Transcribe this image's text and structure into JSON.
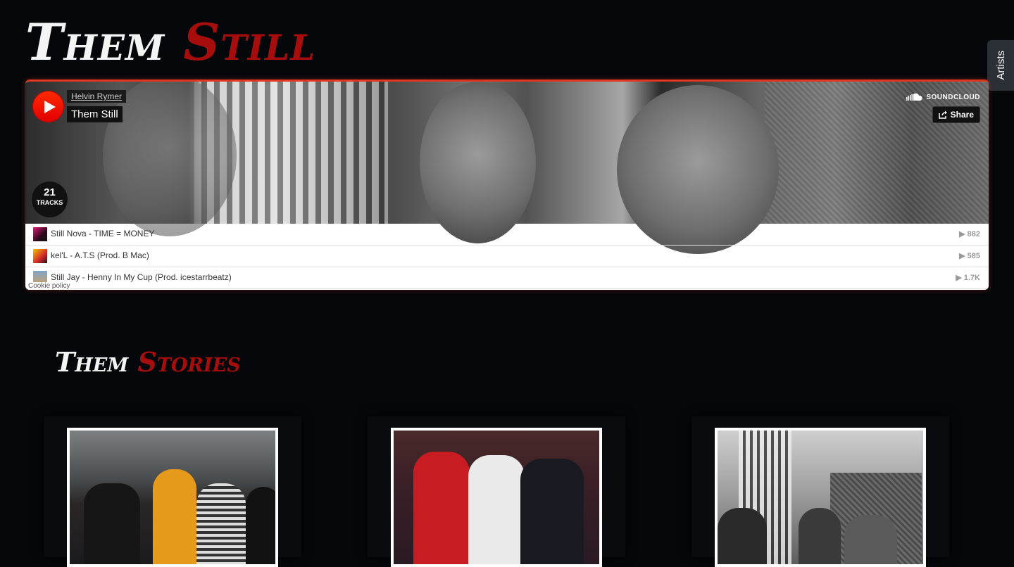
{
  "site": {
    "title_part1": "Them",
    "title_part2": "Still"
  },
  "sidebar_tab": {
    "label": "Artists"
  },
  "player": {
    "artist": "Helvin Rymer",
    "playlist_title": "Them Still",
    "brand": "SOUNDCLOUD",
    "share_label": "Share",
    "track_count": "21",
    "track_count_label": "TRACKS",
    "tracks": [
      {
        "title": "Still Nova - TIME = MONEY",
        "plays": "882"
      },
      {
        "title": "kel'L - A.T.S (Prod. B Mac)",
        "plays": "585"
      },
      {
        "title": "Still Jay - Henny In My Cup (Prod. icestarrbeatz)",
        "plays": "1.7K"
      }
    ],
    "cookie_policy": "Cookie policy"
  },
  "stories": {
    "title_part1": "Them",
    "title_part2": "Stories"
  },
  "colors": {
    "accent_red": "#a70d0d",
    "soundcloud_orange": "#ff5500",
    "background": "#05070b"
  }
}
